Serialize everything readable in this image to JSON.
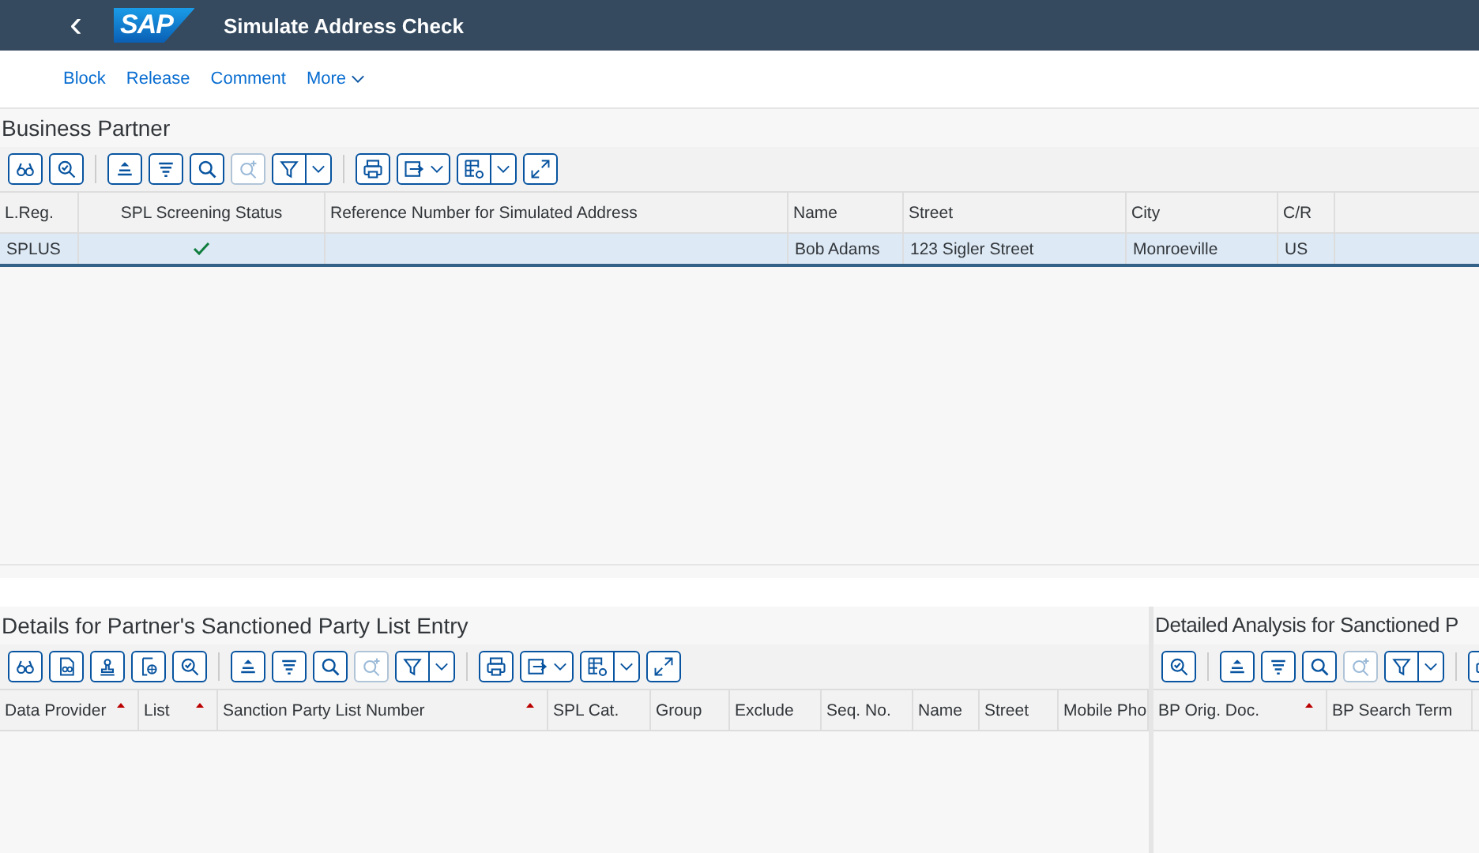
{
  "header": {
    "back": "‹",
    "logo": "SAP",
    "title": "Simulate Address Check"
  },
  "actions": [
    {
      "label": "Block",
      "kind": "link"
    },
    {
      "label": "Release",
      "kind": "link"
    },
    {
      "label": "Comment",
      "kind": "link"
    },
    {
      "label": "More",
      "kind": "menu"
    }
  ],
  "panels": [
    {
      "title": "Business Partner",
      "toolbar": [
        {
          "kind": "button",
          "disabled": false
        },
        {
          "kind": "button",
          "disabled": false
        },
        {
          "kind": "separator"
        },
        {
          "kind": "button",
          "disabled": false
        },
        {
          "kind": "button",
          "disabled": false
        },
        {
          "kind": "button",
          "disabled": false
        },
        {
          "kind": "button",
          "disabled": true
        },
        {
          "kind": "split",
          "disabled": false
        },
        {
          "kind": "separator"
        },
        {
          "kind": "button",
          "disabled": false
        },
        {
          "kind": "menu",
          "disabled": false
        },
        {
          "kind": "split",
          "disabled": false
        },
        {
          "kind": "button",
          "disabled": false
        }
      ],
      "columns": [
        {
          "label": "L.Reg.",
          "sorted": false
        },
        {
          "label": "SPL Screening Status",
          "sorted": false
        },
        {
          "label": "Reference Number for Simulated Address",
          "sorted": false
        },
        {
          "label": "Name",
          "sorted": false
        },
        {
          "label": "Street",
          "sorted": false
        },
        {
          "label": "City",
          "sorted": false
        },
        {
          "label": "C/R",
          "sorted": false
        }
      ],
      "rows": [
        {
          "selected": true,
          "cells": [
            {
              "kind": "text",
              "text": "SPLUS"
            },
            {
              "kind": "check"
            },
            {
              "kind": "text",
              "text": ""
            },
            {
              "kind": "text",
              "text": "Bob Adams"
            },
            {
              "kind": "text",
              "text": "123 Sigler Street"
            },
            {
              "kind": "text",
              "text": "Monroeville"
            },
            {
              "kind": "text",
              "text": "US"
            }
          ]
        }
      ]
    },
    {
      "title": "Details for Partner's Sanctioned Party List Entry",
      "toolbar": [
        {
          "kind": "button",
          "disabled": false
        },
        {
          "kind": "button",
          "disabled": false
        },
        {
          "kind": "button",
          "disabled": false
        },
        {
          "kind": "button",
          "disabled": false
        },
        {
          "kind": "button",
          "disabled": false
        },
        {
          "kind": "separator"
        },
        {
          "kind": "button",
          "disabled": false
        },
        {
          "kind": "button",
          "disabled": false
        },
        {
          "kind": "button",
          "disabled": false
        },
        {
          "kind": "button",
          "disabled": true
        },
        {
          "kind": "split",
          "disabled": false
        },
        {
          "kind": "separator"
        },
        {
          "kind": "button",
          "disabled": false
        },
        {
          "kind": "menu",
          "disabled": false
        },
        {
          "kind": "split",
          "disabled": false
        },
        {
          "kind": "button",
          "disabled": false
        }
      ],
      "columns": [
        {
          "label": "Data Provider",
          "sorted": true
        },
        {
          "label": "List",
          "sorted": true
        },
        {
          "label": "Sanction Party List Number",
          "sorted": true
        },
        {
          "label": "SPL Cat.",
          "sorted": false
        },
        {
          "label": "Group",
          "sorted": false
        },
        {
          "label": "Exclude",
          "sorted": false
        },
        {
          "label": "Seq. No.",
          "sorted": false
        },
        {
          "label": "Name",
          "sorted": false
        },
        {
          "label": "Street",
          "sorted": false
        },
        {
          "label": "Mobile Pho",
          "sorted": false
        }
      ]
    },
    {
      "title": "Detailed Analysis for Sanctioned P",
      "toolbar": [
        {
          "kind": "button",
          "disabled": false
        },
        {
          "kind": "separator"
        },
        {
          "kind": "button",
          "disabled": false
        },
        {
          "kind": "button",
          "disabled": false
        },
        {
          "kind": "button",
          "disabled": false
        },
        {
          "kind": "button",
          "disabled": true
        },
        {
          "kind": "split",
          "disabled": false
        },
        {
          "kind": "separator"
        },
        {
          "kind": "button",
          "disabled": false
        }
      ],
      "columns": [
        {
          "label": "BP Orig. Doc.",
          "sorted": true
        },
        {
          "label": "BP Search Term",
          "sorted": false
        }
      ]
    }
  ]
}
